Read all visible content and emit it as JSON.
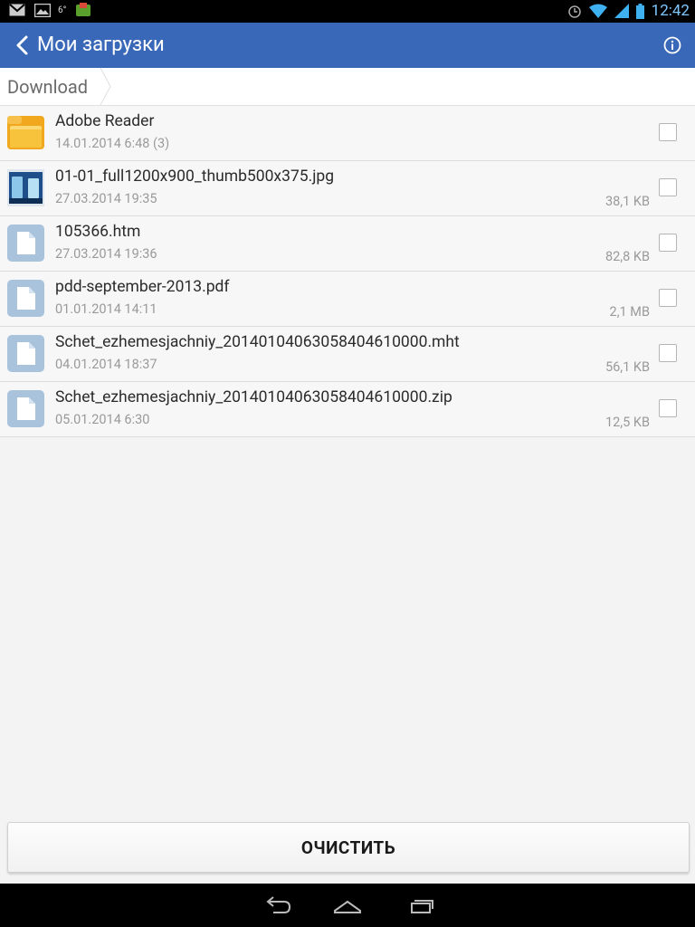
{
  "status_bar": {
    "temperature": "6°",
    "time": "12:42",
    "icons": [
      "gmail-icon",
      "gallery-icon",
      "android-app-icon",
      "alarm-icon",
      "wifi-icon",
      "signal-icon",
      "battery-icon"
    ]
  },
  "app_bar": {
    "title": "Мои загрузки",
    "accent_color": "#3a68b8"
  },
  "breadcrumb": {
    "current": "Download"
  },
  "files": [
    {
      "name": "Adobe Reader",
      "date": "14.01.2014 6:48 (3)",
      "size": "",
      "type": "folder"
    },
    {
      "name": "01-01_full1200x900_thumb500x375.jpg",
      "date": "27.03.2014 19:35",
      "size": "38,1 KB",
      "type": "image"
    },
    {
      "name": "105366.htm",
      "date": "27.03.2014 19:36",
      "size": "82,8 KB",
      "type": "file"
    },
    {
      "name": "pdd-september-2013.pdf",
      "date": "01.01.2014 14:11",
      "size": "2,1 MB",
      "type": "file"
    },
    {
      "name": "Schet_ezhemesjachniy_20140104063058404610000.mht",
      "date": "04.01.2014 18:37",
      "size": "56,1 KB",
      "type": "file"
    },
    {
      "name": "Schet_ezhemesjachniy_20140104063058404610000.zip",
      "date": "05.01.2014 6:30",
      "size": "12,5 KB",
      "type": "file"
    }
  ],
  "clear_button": {
    "label": "ОЧИСТИТЬ"
  },
  "nav_bar": {
    "buttons": [
      "back-nav-icon",
      "home-nav-icon",
      "recents-nav-icon"
    ]
  }
}
